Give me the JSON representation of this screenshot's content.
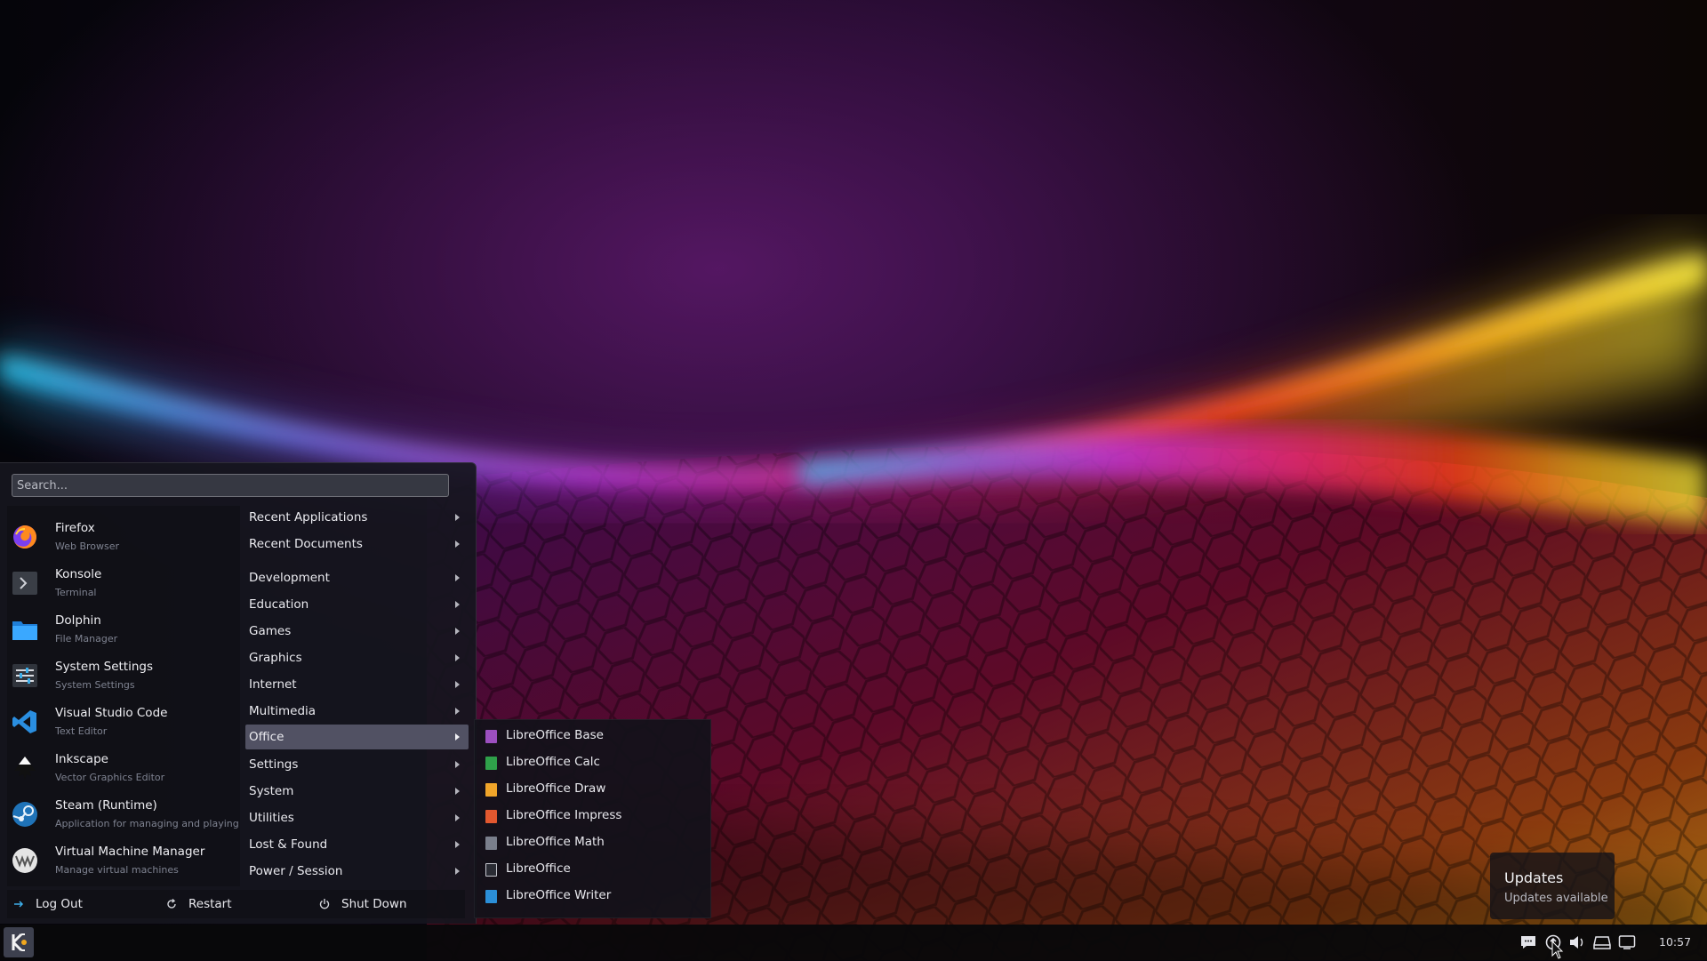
{
  "search": {
    "placeholder": "Search..."
  },
  "favorites": [
    {
      "name": "Firefox",
      "description": "Web Browser",
      "icon": "firefox-icon"
    },
    {
      "name": "Konsole",
      "description": "Terminal",
      "icon": "konsole-icon"
    },
    {
      "name": "Dolphin",
      "description": "File Manager",
      "icon": "folder-icon"
    },
    {
      "name": "System Settings",
      "description": "System Settings",
      "icon": "settings-icon"
    },
    {
      "name": "Visual Studio Code",
      "description": "Text Editor",
      "icon": "vscode-icon"
    },
    {
      "name": "Inkscape",
      "description": "Vector Graphics Editor",
      "icon": "inkscape-icon"
    },
    {
      "name": "Steam (Runtime)",
      "description": "Application for managing and playing",
      "icon": "steam-icon"
    },
    {
      "name": "Virtual Machine Manager",
      "description": "Manage virtual machines",
      "icon": "vm-icon"
    }
  ],
  "categories": [
    {
      "label": "Recent Applications"
    },
    {
      "label": "Recent Documents"
    },
    {
      "label": "Development"
    },
    {
      "label": "Education"
    },
    {
      "label": "Games"
    },
    {
      "label": "Graphics"
    },
    {
      "label": "Internet"
    },
    {
      "label": "Multimedia"
    },
    {
      "label": "Office",
      "active": true
    },
    {
      "label": "Settings"
    },
    {
      "label": "System"
    },
    {
      "label": "Utilities"
    },
    {
      "label": "Lost & Found"
    },
    {
      "label": "Power / Session"
    }
  ],
  "office_submenu": [
    {
      "label": "LibreOffice Base",
      "color": "#9c4fbf"
    },
    {
      "label": "LibreOffice Calc",
      "color": "#2fa04a"
    },
    {
      "label": "LibreOffice Draw",
      "color": "#f0a52a"
    },
    {
      "label": "LibreOffice Impress",
      "color": "#e2582f"
    },
    {
      "label": "LibreOffice Math",
      "color": "#7a7f8c"
    },
    {
      "label": "LibreOffice",
      "color": "#c6c8cf"
    },
    {
      "label": "LibreOffice Writer",
      "color": "#2b8fd8"
    }
  ],
  "power": {
    "logout": "Log Out",
    "restart": "Restart",
    "shutdown": "Shut Down"
  },
  "notification": {
    "title": "Updates",
    "body": "Updates available"
  },
  "taskbar": {
    "clock": "10:57",
    "tray_icons": [
      "notifications-icon",
      "updates-icon",
      "volume-icon",
      "storage-icon",
      "display-icon"
    ]
  },
  "colors": {
    "accent": "#5c5c70",
    "panel": "#16161e"
  }
}
